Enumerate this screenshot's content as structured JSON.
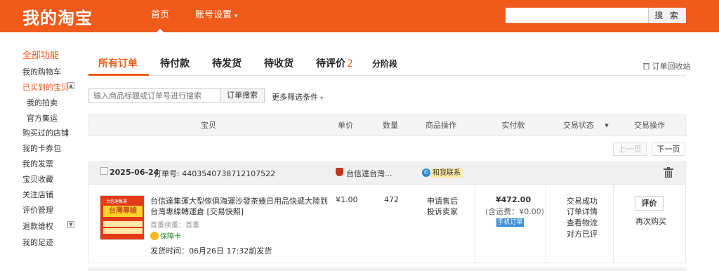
{
  "header": {
    "logo": "我的淘宝",
    "nav_home": "首页",
    "nav_settings": "账号设置",
    "search_button": "搜 索"
  },
  "sidebar": {
    "title": "全部功能",
    "items": [
      {
        "label": "我的购物车"
      },
      {
        "label": "已买到的宝贝"
      },
      {
        "label": "我的拍卖"
      },
      {
        "label": "官方集运"
      },
      {
        "label": "购买过的店铺"
      },
      {
        "label": "我的卡券包"
      },
      {
        "label": "我的发票"
      },
      {
        "label": "宝贝收藏"
      },
      {
        "label": "关注店铺"
      },
      {
        "label": "评价管理"
      },
      {
        "label": "退款维权"
      },
      {
        "label": "我的足迹"
      }
    ]
  },
  "tabs": [
    {
      "label": "所有订单",
      "count": ""
    },
    {
      "label": "待付款",
      "count": ""
    },
    {
      "label": "待发货",
      "count": ""
    },
    {
      "label": "待收货",
      "count": ""
    },
    {
      "label": "待评价",
      "count": "2"
    },
    {
      "label": "分阶段",
      "count": ""
    }
  ],
  "recycle_bin": "订单回收站",
  "filter": {
    "search_placeholder": "输入商品标题或订单号进行搜索",
    "search_button": "订单搜索",
    "more_filters": "更多筛选条件"
  },
  "table_headers": [
    "宝贝",
    "单价",
    "数量",
    "商品操作",
    "实付款",
    "交易状态",
    "交易操作"
  ],
  "pager": {
    "prev": "上一页",
    "next": "下一页"
  },
  "order": {
    "date": "2025-06-24",
    "order_no": "订单号: 4403540738712107522",
    "shop_name": "台信達台灣...",
    "chat": "和我联系",
    "product": {
      "image_text_top": "台信達集運",
      "image_text_main": "台灣專線",
      "title": "台信達集運大型傢俱海運沙發茶幾日用品快遞大陸到台灣專線轉運倉 [交易快照]",
      "attr": "首重续重：首重",
      "badge": "保障卡",
      "ship_time": "发货时间：06月26日 17:32前发货"
    },
    "unit_price": "¥1.00",
    "quantity": "472",
    "ops": [
      "申请售后",
      "投诉卖家"
    ],
    "paid": "¥472.00",
    "shipping_fee": "(含运费：¥0.00)",
    "mobile_badge": "手机订单",
    "status": [
      "交易成功",
      "订单详情",
      "查看物流",
      "对方已评"
    ],
    "review_button": "评价",
    "buy_again": "再次购买"
  },
  "colors": {
    "brand": "#f05a1a"
  }
}
